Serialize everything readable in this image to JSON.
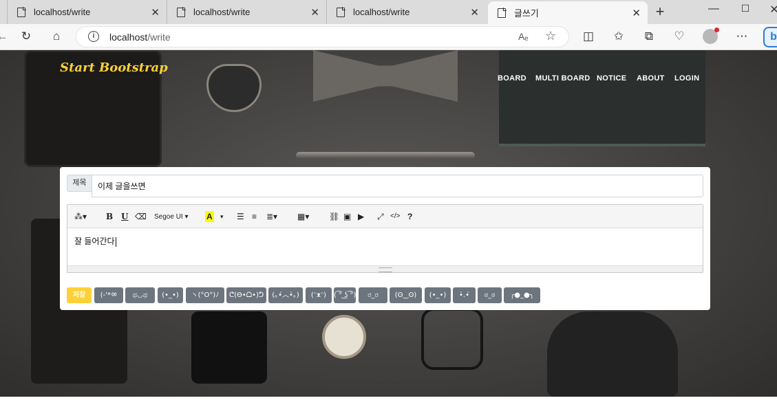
{
  "browser": {
    "tabs": [
      {
        "title": "localhost/write",
        "active": false
      },
      {
        "title": "localhost/write",
        "active": false
      },
      {
        "title": "localhost/write",
        "active": false
      },
      {
        "title": "글쓰기",
        "active": true
      }
    ],
    "close_glyph": "✕",
    "new_tab_glyph": "+",
    "address": {
      "host": "localhost",
      "path": "/write",
      "read_aloud": "Aₑ",
      "favorite_glyph": "☆"
    },
    "window": {
      "minimize": "—",
      "maximize": "☐",
      "close": "✕"
    }
  },
  "site": {
    "brand": "Start Bootstrap",
    "nav": [
      "BOARD",
      "MULTI BOARD",
      "NOTICE",
      "ABOUT",
      "LOGIN"
    ]
  },
  "form": {
    "title_label": "제목",
    "title_value": "이제 글을쓰면",
    "body_text": "잘 들어간다",
    "toolbar": {
      "magic": "⁂▾",
      "bold": "B",
      "underline": "U",
      "eraser": "⌫",
      "font": "Segoe UI ▾",
      "color": "A",
      "color_caret": "▾",
      "ul": "☰",
      "ol": "≡",
      "align": "≣▾",
      "table": "▦▾",
      "link": "⛓",
      "image": "▣",
      "video": "▶",
      "fullscreen": "⤢",
      "code": "</>",
      "help": "?"
    },
    "buttons": {
      "save": "저장",
      "emoticons": [
        "(-'*ㆀ",
        "ಥ◡ಥ",
        "(•_•)",
        "ヽ(°O°)ﾉ",
        "ᕦ(Θ•ᗝ•)ᕤ",
        "(｡•́︿•̀｡)",
        "(ᵔᴥᵔ)",
        "( ͡° ͜ʖ ͡°)",
        "ರ_ರ",
        "(ʘ‿ʘ)",
        "(•_•)",
        "•̀.•́",
        "ಠ_ಠ",
        "╭●_●╮"
      ]
    }
  }
}
